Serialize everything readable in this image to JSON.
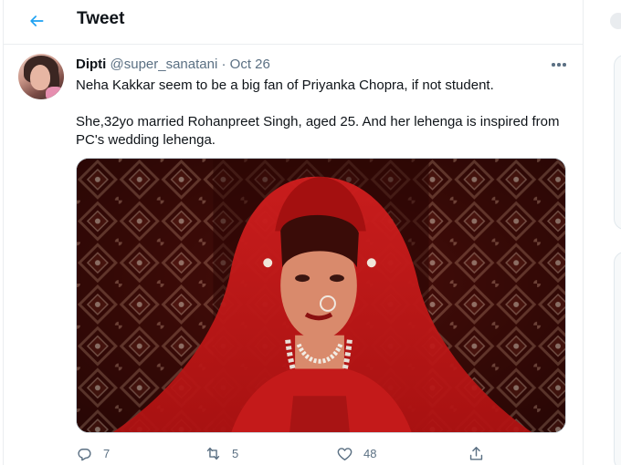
{
  "header": {
    "title": "Tweet"
  },
  "tweet": {
    "author_name": "Dipti",
    "handle": "@super_sanatani",
    "separator": "·",
    "date": "Oct 26",
    "paragraphs": [
      "Neha Kakkar seem to be a big fan of Priyanka Chopra, if not student.",
      "She,32yo married Rohanpreet Singh, aged 25. And her lehenga is inspired from PC's wedding lehenga."
    ],
    "stats": {
      "replies": "7",
      "retweets": "5",
      "likes": "48"
    }
  },
  "icons": {
    "back": "arrow-left-icon",
    "more": "more-dots-icon",
    "reply": "reply-icon",
    "retweet": "retweet-icon",
    "like": "heart-icon",
    "share": "share-icon"
  },
  "colors": {
    "accent": "#1da1f2",
    "text_primary": "#0f1419",
    "text_secondary": "#5b7083",
    "border": "#ebeef0",
    "media_red": "#c41a1a"
  }
}
